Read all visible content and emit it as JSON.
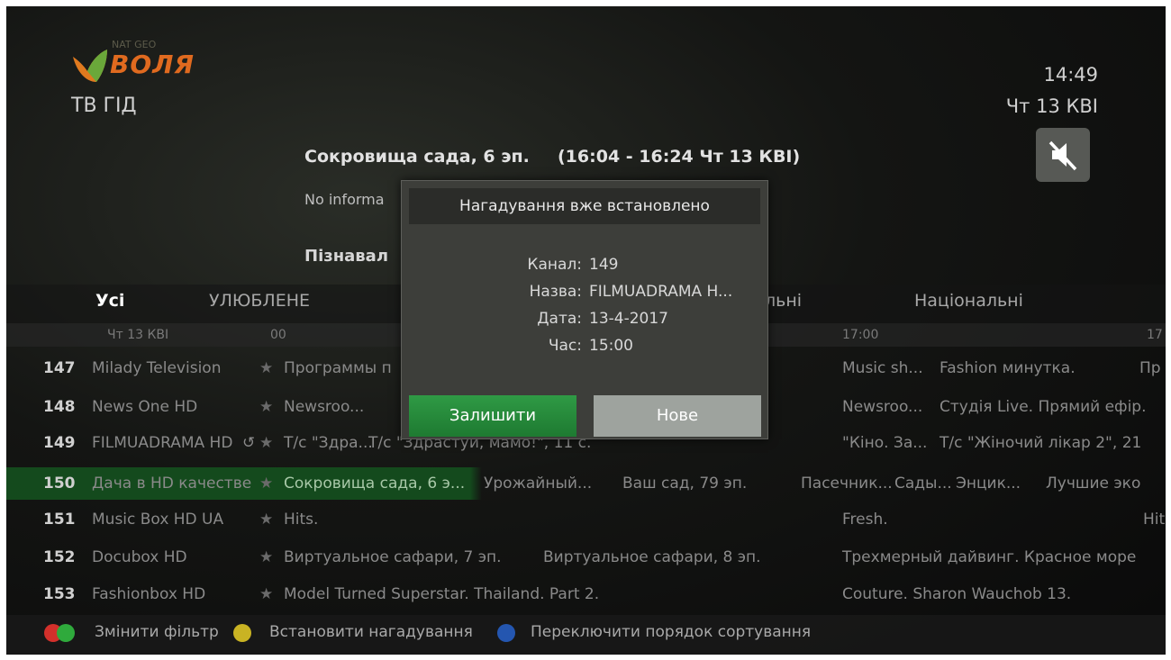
{
  "header": {
    "logo_small": "NAT GEO",
    "logo_word": "ВОЛЯ",
    "title": "ТВ ГІД",
    "time": "14:49",
    "date": "Чт 13 КВІ",
    "mute_icon": "speaker-muted-icon"
  },
  "program": {
    "title": "Сокровища сада, 6 эп.",
    "time": "(16:04 - 16:24 Чт 13 КВІ)",
    "info": "No informa",
    "more": "Пізнавал"
  },
  "filters": [
    "Усі",
    "УЛЮБЛЕНЕ",
    "льні",
    "Національні"
  ],
  "timeline": {
    "date": "Чт 13 КВІ",
    "t1": "00",
    "t2": "17:00",
    "t3": "17"
  },
  "channels": [
    {
      "num": "147",
      "name": "Milady Television",
      "cells": [
        {
          "t": "Программы п"
        },
        {
          "t": "Music sh..."
        },
        {
          "t": "Fashion минутка."
        },
        {
          "t": "Пр"
        }
      ]
    },
    {
      "num": "148",
      "name": "News One HD",
      "cells": [
        {
          "t": "Newsroo..."
        },
        {
          "t": "Newsroo..."
        },
        {
          "t": "Студія Live. Прямий ефір."
        }
      ]
    },
    {
      "num": "149",
      "name": "FILMUADRAMA HD",
      "cells": [
        {
          "t": "Т/с \"Здра..."
        },
        {
          "t": "Т/с \"Здрастуй, мамо!\", 11 с."
        },
        {
          "t": "\"Кіно. За..."
        },
        {
          "t": "Т/с \"Жіночий лікар 2\", 21"
        }
      ]
    },
    {
      "num": "150",
      "name": "Дача в HD качестве",
      "cells": [
        {
          "t": "Сокровища сада, 6 э..."
        },
        {
          "t": "Урожайный..."
        },
        {
          "t": "Ваш сад, 79 эп."
        },
        {
          "t": "Пасечник..."
        },
        {
          "t": "Сады..."
        },
        {
          "t": "Энцик..."
        },
        {
          "t": "Лучшие эко"
        }
      ]
    },
    {
      "num": "151",
      "name": "Music Box HD UA",
      "cells": [
        {
          "t": "Hits."
        },
        {
          "t": "Fresh."
        },
        {
          "t": "Hit"
        }
      ]
    },
    {
      "num": "152",
      "name": "Docubox HD",
      "cells": [
        {
          "t": "Виртуальное сафари, 7 эп."
        },
        {
          "t": "Виртуальное сафари, 8 эп."
        },
        {
          "t": "Трехмерный дайвинг. Красное море"
        }
      ]
    },
    {
      "num": "153",
      "name": "Fashionbox HD",
      "cells": [
        {
          "t": "Model Turned Superstar. Thailand. Part 2."
        },
        {
          "t": "Couture. Sharon Wauchob 13."
        }
      ]
    }
  ],
  "footer": {
    "change_filter": "Змінити фільтр",
    "set_reminder": "Встановити нагадування",
    "toggle_sort": "Переключити порядок сортування",
    "colors": {
      "red": "#d3302b",
      "green": "#2faa3c",
      "yellow": "#c9b323",
      "blue": "#2456b0"
    }
  },
  "dialog": {
    "title": "Нагадування вже встановлено",
    "channel_label": "Канал:",
    "channel_value": "149",
    "name_label": "Назва:",
    "name_value": "FILMUADRAMA H...",
    "date_label": "Дата:",
    "date_value": "13-4-2017",
    "time_label": "Час:",
    "time_value": "15:00",
    "keep_button": "Залишити",
    "new_button": "Нове"
  }
}
